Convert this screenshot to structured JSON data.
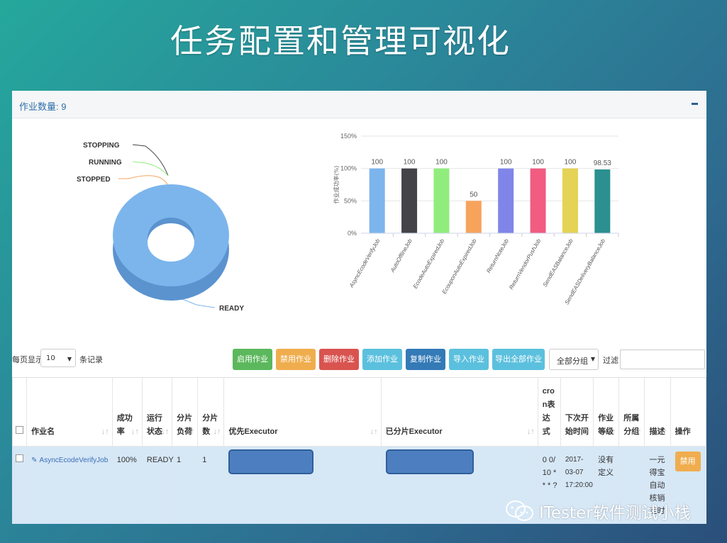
{
  "slide": {
    "title": "任务配置和管理可视化"
  },
  "panel": {
    "title": "作业数量: 9"
  },
  "pie": {
    "labels": [
      "STOPPING",
      "RUNNING",
      "STOPPED",
      "READY"
    ],
    "colors": {
      "ring": "#7cb5ec",
      "ring_side": "#5b93cf",
      "stopping": "#434348",
      "running": "#90ed7d",
      "stopped": "#f7a35c",
      "ready": "#7cb5ec"
    }
  },
  "chart_data": {
    "type": "bar",
    "ylabel": "作业成功率(%)",
    "yticks": [
      "150%",
      "100%",
      "50%",
      "0%"
    ],
    "ylim": [
      0,
      150
    ],
    "grid": true,
    "categories": [
      "AsyncEcodeVerifyJob",
      "AutoOfflineJob",
      "EcodeAutoExpiredJob",
      "EcouponAutoExpiredJob",
      "ReturnNoteJob",
      "ReturnVendorPushJob",
      "SendEASBalanceJob",
      "SendEASDeliveryBalanceJob"
    ],
    "values": [
      100,
      100,
      100,
      50,
      100,
      100,
      100,
      98.53
    ],
    "value_labels": [
      "100",
      "100",
      "100",
      "50",
      "100",
      "100",
      "100",
      "98.53"
    ],
    "colors": [
      "#7cb5ec",
      "#434348",
      "#90ed7d",
      "#f7a35c",
      "#8085e9",
      "#f15c80",
      "#e4d354",
      "#2b908f"
    ]
  },
  "toolbar": {
    "length_prefix": "每页显示",
    "length_value": "10",
    "length_suffix": "条记录",
    "buttons": [
      {
        "label": "启用作业",
        "color": "#5cb85c"
      },
      {
        "label": "禁用作业",
        "color": "#f0ad4e"
      },
      {
        "label": "删除作业",
        "color": "#d9534f"
      },
      {
        "label": "添加作业",
        "color": "#5bc0de"
      },
      {
        "label": "复制作业",
        "color": "#337ab7"
      },
      {
        "label": "导入作业",
        "color": "#5bc0de"
      },
      {
        "label": "导出全部作业",
        "color": "#5bc0de"
      }
    ],
    "group_select": "全部分组",
    "filter_label": "过滤"
  },
  "table": {
    "headers": [
      "作业名",
      "成功率",
      "运行状态",
      "分片负荷",
      "分片数",
      "优先Executor",
      "已分片Executor",
      "cron表达式",
      "下次开始时间",
      "作业等级",
      "所属分组",
      "描述",
      "操作"
    ],
    "rows": [
      {
        "name": "AsyncEcodeVerifyJob",
        "success_rate": "100%",
        "status": "READY",
        "load": "1",
        "shards": "1",
        "cron": "0 0/10 * * * ?",
        "next_time": "2017-03-07 17:20:00",
        "level": "没有定义",
        "group": "",
        "desc": "一元得宝自动核销定时",
        "action": "禁用"
      }
    ]
  },
  "watermark": {
    "text": "ITester软件测试小栈"
  }
}
